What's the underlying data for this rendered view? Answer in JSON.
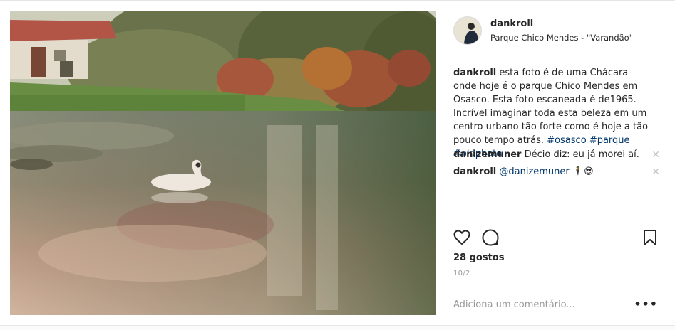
{
  "post": {
    "username": "dankroll",
    "location": "Parque Chico Mendes - \"Varandão\"",
    "caption": {
      "username": "dankroll",
      "text": "esta foto é de uma Chácara onde hoje é o parque Chico Mendes em Osasco. Esta foto escaneada é de1965. Incrível imaginar toda esta beleza em um centro urbano tão forte como é hoje a tão pouco tempo atrás.",
      "hashtags": [
        "#osasco",
        "#parque",
        "#oldphoto"
      ]
    },
    "comments": [
      {
        "username": "danizemuner",
        "text": "Décio diz: eu já morei aí."
      },
      {
        "username": "dankroll",
        "mention": "@danizemuner",
        "emoji": "🕴😎"
      }
    ],
    "likes": "28 gostos",
    "date": "10/2",
    "add_comment_placeholder": "Adiciona um comentário...",
    "more_label": "•••",
    "close_glyph": "✕"
  },
  "icons": {
    "like": "heart-icon",
    "comment": "comment-icon",
    "save": "bookmark-icon",
    "more": "ellipsis-icon",
    "delete": "close-icon"
  },
  "colors": {
    "text": "#262626",
    "hashtag": "#003569",
    "muted": "#999999",
    "border": "#efefef"
  }
}
